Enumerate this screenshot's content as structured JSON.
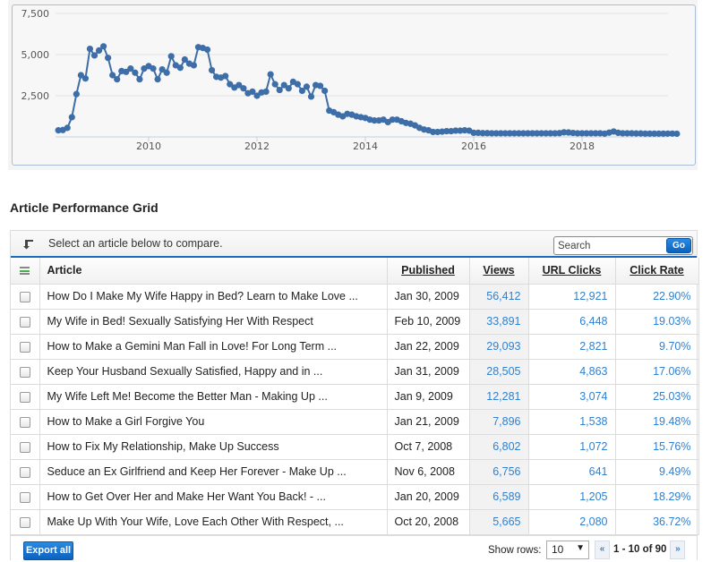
{
  "chart_data": {
    "type": "line",
    "title": "",
    "xlabel": "",
    "ylabel": "",
    "x_ticks": [
      "2010",
      "2012",
      "2014",
      "2016",
      "2018"
    ],
    "y_ticks": [
      "2,500",
      "5,000",
      "7,500"
    ],
    "ylim": [
      0,
      7500
    ],
    "xlim": [
      2008.25,
      2019.75
    ],
    "grid": true,
    "legend": "none",
    "series": [
      {
        "name": "Views",
        "color": "#3d6ea8",
        "x_start": "2008-05",
        "interval": "month",
        "values": [
          400,
          420,
          550,
          1200,
          2600,
          3750,
          3550,
          5350,
          4950,
          5250,
          5500,
          4800,
          3750,
          3500,
          4000,
          3950,
          4150,
          3900,
          3500,
          4150,
          4300,
          4150,
          3500,
          4100,
          3900,
          4900,
          4350,
          4200,
          4700,
          4450,
          4350,
          5450,
          5400,
          5300,
          4050,
          3650,
          3600,
          3700,
          3200,
          3000,
          3150,
          2950,
          2650,
          2750,
          2500,
          2700,
          2750,
          3800,
          3200,
          2850,
          3150,
          2950,
          3350,
          3200,
          2800,
          3050,
          2450,
          3150,
          3100,
          2800,
          1600,
          1500,
          1350,
          1250,
          1400,
          1350,
          1250,
          1200,
          1150,
          1050,
          1000,
          1000,
          1050,
          900,
          1050,
          1050,
          950,
          850,
          800,
          700,
          550,
          450,
          400,
          300,
          300,
          320,
          350,
          350,
          380,
          380,
          400,
          380,
          250,
          250,
          230,
          230,
          220,
          220,
          220,
          220,
          220,
          220,
          220,
          220,
          220,
          220,
          220,
          220,
          220,
          220,
          220,
          230,
          280,
          270,
          240,
          220,
          220,
          220,
          220,
          220,
          220,
          200,
          260,
          330,
          250,
          220,
          220,
          220,
          210,
          210,
          200,
          200,
          200,
          200,
          200,
          200,
          200,
          190
        ]
      }
    ]
  },
  "section": {
    "title": "Article Performance Grid"
  },
  "toolbar": {
    "compare_hint": "Select an article below to compare.",
    "search_placeholder": "Search",
    "go_label": "Go"
  },
  "table": {
    "columns": {
      "article": "Article",
      "published": "Published",
      "views": "Views",
      "url_clicks": "URL Clicks",
      "click_rate": "Click Rate"
    },
    "rows": [
      {
        "article": "How Do I Make My Wife Happy in Bed? Learn to Make Love ...",
        "published": "Jan 30, 2009",
        "views": "56,412",
        "url_clicks": "12,921",
        "click_rate": "22.90%"
      },
      {
        "article": "My Wife in Bed! Sexually Satisfying Her With Respect",
        "published": "Feb 10, 2009",
        "views": "33,891",
        "url_clicks": "6,448",
        "click_rate": "19.03%"
      },
      {
        "article": "How to Make a Gemini Man Fall in Love! For Long Term ...",
        "published": "Jan 22, 2009",
        "views": "29,093",
        "url_clicks": "2,821",
        "click_rate": "9.70%"
      },
      {
        "article": "Keep Your Husband Sexually Satisfied, Happy and in ...",
        "published": "Jan 31, 2009",
        "views": "28,505",
        "url_clicks": "4,863",
        "click_rate": "17.06%"
      },
      {
        "article": "My Wife Left Me! Become the Better Man - Making Up ...",
        "published": "Jan 9, 2009",
        "views": "12,281",
        "url_clicks": "3,074",
        "click_rate": "25.03%"
      },
      {
        "article": "How to Make a Girl Forgive You",
        "published": "Jan 21, 2009",
        "views": "7,896",
        "url_clicks": "1,538",
        "click_rate": "19.48%"
      },
      {
        "article": "How to Fix My Relationship, Make Up Success",
        "published": "Oct 7, 2008",
        "views": "6,802",
        "url_clicks": "1,072",
        "click_rate": "15.76%"
      },
      {
        "article": "Seduce an Ex Girlfriend and Keep Her Forever - Make Up ...",
        "published": "Nov 6, 2008",
        "views": "6,756",
        "url_clicks": "641",
        "click_rate": "9.49%"
      },
      {
        "article": "How to Get Over Her and Make Her Want You Back! - ...",
        "published": "Jan 20, 2009",
        "views": "6,589",
        "url_clicks": "1,205",
        "click_rate": "18.29%"
      },
      {
        "article": "Make Up With Your Wife, Love Each Other With Respect, ...",
        "published": "Oct 20, 2008",
        "views": "5,665",
        "url_clicks": "2,080",
        "click_rate": "36.72%"
      }
    ]
  },
  "footer": {
    "export_label": "Export all",
    "show_rows_label": "Show rows:",
    "rows_value": "10",
    "page_info": "1 - 10 of 90",
    "prev_label": "«",
    "next_label": "»"
  },
  "icons": {
    "compare": "arrow-down-left-icon",
    "column_menu": "list-icon",
    "dropdown": "▼"
  },
  "colors": {
    "accent": "#1a6bbf",
    "link": "#2f80d1",
    "series": "#3d6ea8",
    "list_icon_green": "#4caf50"
  }
}
